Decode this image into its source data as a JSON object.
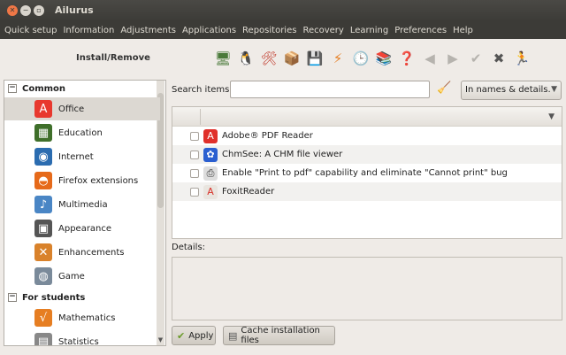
{
  "window": {
    "title": "Ailurus"
  },
  "menu": [
    "Quick setup",
    "Information",
    "Adjustments",
    "Applications",
    "Repositories",
    "Recovery",
    "Learning",
    "Preferences",
    "Help"
  ],
  "toolbar": {
    "title": "Install/Remove",
    "icons": [
      {
        "name": "monitor-icon",
        "glyph": "🖥",
        "color": "#4a7a3a"
      },
      {
        "name": "tux-icon",
        "glyph": "🐧",
        "color": "#222222"
      },
      {
        "name": "tools-icon",
        "glyph": "🛠",
        "color": "#c0392b"
      },
      {
        "name": "package-add-icon",
        "glyph": "📦",
        "color": "#8a6a2a"
      },
      {
        "name": "floppy-icon",
        "glyph": "💾",
        "color": "#333333"
      },
      {
        "name": "lightning-icon",
        "glyph": "⚡",
        "color": "#e67e22"
      },
      {
        "name": "clock-icon",
        "glyph": "🕒",
        "color": "#333333"
      },
      {
        "name": "books-icon",
        "glyph": "📚",
        "color": "#b03a2e"
      },
      {
        "name": "help-icon",
        "glyph": "❓",
        "color": "#c9a227"
      },
      {
        "name": "back-arrow-icon",
        "glyph": "◀",
        "color": "#b6b3ae"
      },
      {
        "name": "forward-arrow-icon",
        "glyph": "▶",
        "color": "#b6b3ae"
      },
      {
        "name": "check-icon",
        "glyph": "✔",
        "color": "#b6b3ae"
      },
      {
        "name": "close-icon",
        "glyph": "✖",
        "color": "#555555"
      },
      {
        "name": "run-icon",
        "glyph": "🏃",
        "color": "#3aa13a"
      }
    ]
  },
  "sidebar": {
    "categories": [
      {
        "label": "Common",
        "expander": "−",
        "items": [
          {
            "label": "Office",
            "icon": "office-icon",
            "glyph": "A",
            "bg": "#e8382e",
            "fg": "#ffffff",
            "selected": true
          },
          {
            "label": "Education",
            "icon": "education-icon",
            "glyph": "▦",
            "bg": "#3f6f2a",
            "fg": "#ffffff"
          },
          {
            "label": "Internet",
            "icon": "globe-icon",
            "glyph": "◉",
            "bg": "#2b6cb0",
            "fg": "#ffffff"
          },
          {
            "label": "Firefox extensions",
            "icon": "firefox-icon",
            "glyph": "◓",
            "bg": "#e66a1a",
            "fg": "#ffffff"
          },
          {
            "label": "Multimedia",
            "icon": "multimedia-icon",
            "glyph": "♪",
            "bg": "#4a86c5",
            "fg": "#ffffff"
          },
          {
            "label": "Appearance",
            "icon": "appearance-icon",
            "glyph": "▣",
            "bg": "#555555",
            "fg": "#ffffff"
          },
          {
            "label": "Enhancements",
            "icon": "enhancements-icon",
            "glyph": "✕",
            "bg": "#d9822b",
            "fg": "#ffffff"
          },
          {
            "label": "Game",
            "icon": "gamepad-icon",
            "glyph": "◍",
            "bg": "#7a8a9a",
            "fg": "#ffffff"
          }
        ]
      },
      {
        "label": "For students",
        "expander": "−",
        "items": [
          {
            "label": "Mathematics",
            "icon": "mathematics-icon",
            "glyph": "√",
            "bg": "#e67e22",
            "fg": "#ffffff"
          },
          {
            "label": "Statistics",
            "icon": "statistics-icon",
            "glyph": "▤",
            "bg": "#888888",
            "fg": "#ffffff"
          }
        ]
      }
    ]
  },
  "search": {
    "label": "Search items:",
    "value": "",
    "placeholder": "",
    "scope": "In names & details."
  },
  "apps": [
    {
      "label": "Adobe® PDF Reader",
      "icon": "adobe-reader-icon",
      "glyph": "A",
      "bg": "#e0302a",
      "fg": "#ffffff"
    },
    {
      "label": "ChmSee: A CHM file viewer",
      "icon": "chmsee-icon",
      "glyph": "✿",
      "bg": "#2b5fd0",
      "fg": "#ffffff"
    },
    {
      "label": "Enable \"Print to pdf\" capability and eliminate \"Cannot print\" bug",
      "icon": "printer-icon",
      "glyph": "⎙",
      "bg": "#dddddd",
      "fg": "#333333"
    },
    {
      "label": "FoxitReader",
      "icon": "foxit-reader-icon",
      "glyph": "A",
      "bg": "#e9e5df",
      "fg": "#d8322a"
    }
  ],
  "details": {
    "label": "Details:",
    "text": ""
  },
  "buttons": {
    "apply": {
      "label": "Apply",
      "glyph": "✔",
      "color": "#6a9a2a"
    },
    "cache": {
      "label": "Cache installation files",
      "glyph": "▤",
      "color": "#555555"
    }
  }
}
